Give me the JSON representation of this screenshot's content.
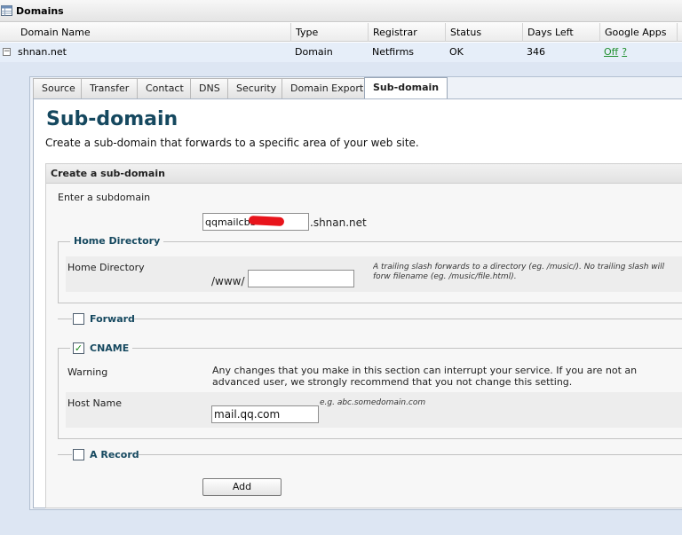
{
  "window": {
    "title": "Domains"
  },
  "grid": {
    "headers": [
      "Domain Name",
      "Type",
      "Registrar",
      "Status",
      "Days Left",
      "Google Apps"
    ],
    "row": {
      "domain": "shnan.net",
      "type": "Domain",
      "registrar": "Netfirms",
      "status": "OK",
      "days_left": "346",
      "google_apps": "Off",
      "help": "?"
    }
  },
  "tabs": [
    "Source",
    "Transfer",
    "Contact",
    "DNS",
    "Security",
    "Domain Export",
    "Sub-domain"
  ],
  "active_tab": "Sub-domain",
  "page": {
    "title": "Sub-domain",
    "subtitle": "Create a sub-domain that forwards to a specific area of your web site."
  },
  "form": {
    "header": "Create a sub-domain",
    "subdomain_label": "Enter a subdomain",
    "subdomain_value": "qqmailcbb",
    "domain_suffix": ".shnan.net",
    "home_directory": {
      "legend": "Home Directory",
      "label": "Home Directory",
      "prefix": "/www/",
      "value": "",
      "hint": "A trailing slash forwards to a directory (eg. /music/). No trailing slash will forw filename (eg. /music/file.html)."
    },
    "forward": {
      "label": "Forward",
      "checked": false
    },
    "cname": {
      "label": "CNAME",
      "checked": true,
      "warning_label": "Warning",
      "warning_text": "Any changes that you make in this section can interrupt your service. If you are not an advanced user, we strongly recommend that you not change this setting.",
      "host_label": "Host Name",
      "host_hint": "e.g. abc.somedomain.com",
      "host_value": "mail.qq.com"
    },
    "a_record": {
      "label": "A Record",
      "checked": false
    },
    "add_button": "Add"
  },
  "colors": {
    "title": "#15485f",
    "selected_row": "#e6eef9",
    "link": "#1f8f2e",
    "check": "#1a8a1a"
  }
}
